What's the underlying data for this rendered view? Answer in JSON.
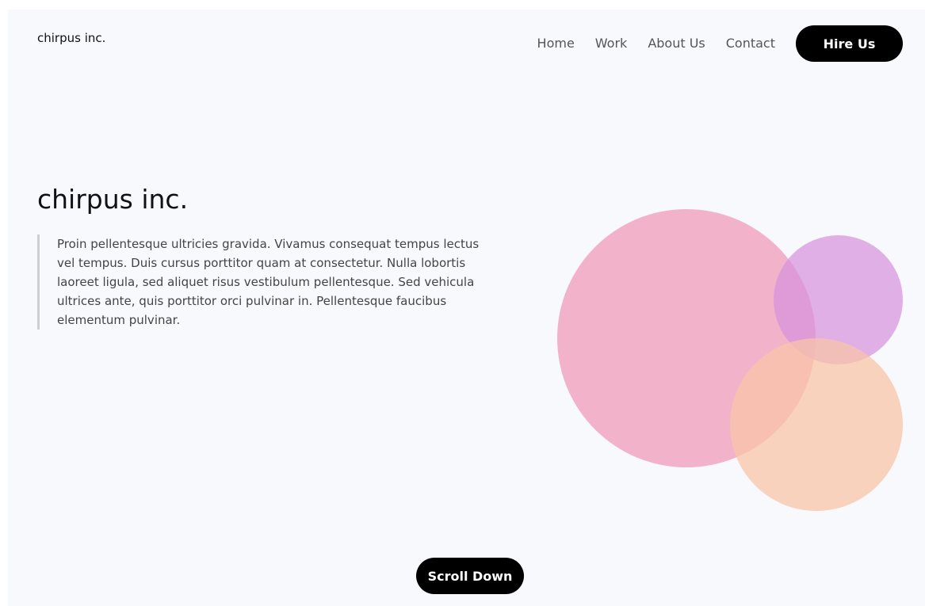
{
  "header": {
    "logo": "chirpus inc.",
    "nav": [
      {
        "label": "Home"
      },
      {
        "label": "Work"
      },
      {
        "label": "About Us"
      },
      {
        "label": "Contact"
      }
    ],
    "hire_label": "Hire Us"
  },
  "hero": {
    "title": "chirpus inc.",
    "description": "Proin pellentesque ultricies gravida. Vivamus consequat tempus lectus vel tempus. Duis cursus porttitor quam at consectetur. Nulla lobortis laoreet ligula, sed aliquet risus vestibulum pellentesque. Sed vehicula ultrices ante, quis porttitor orci pulvinar in. Pellentesque faucibus elementum pulvinar."
  },
  "decor": {
    "pink": "rgba(240, 161, 189, 0.8)",
    "purple": "rgba(215, 145, 222, 0.72)",
    "peach": "rgba(248, 196, 168, 0.75)"
  },
  "footer": {
    "scroll_label": "Scroll Down"
  }
}
